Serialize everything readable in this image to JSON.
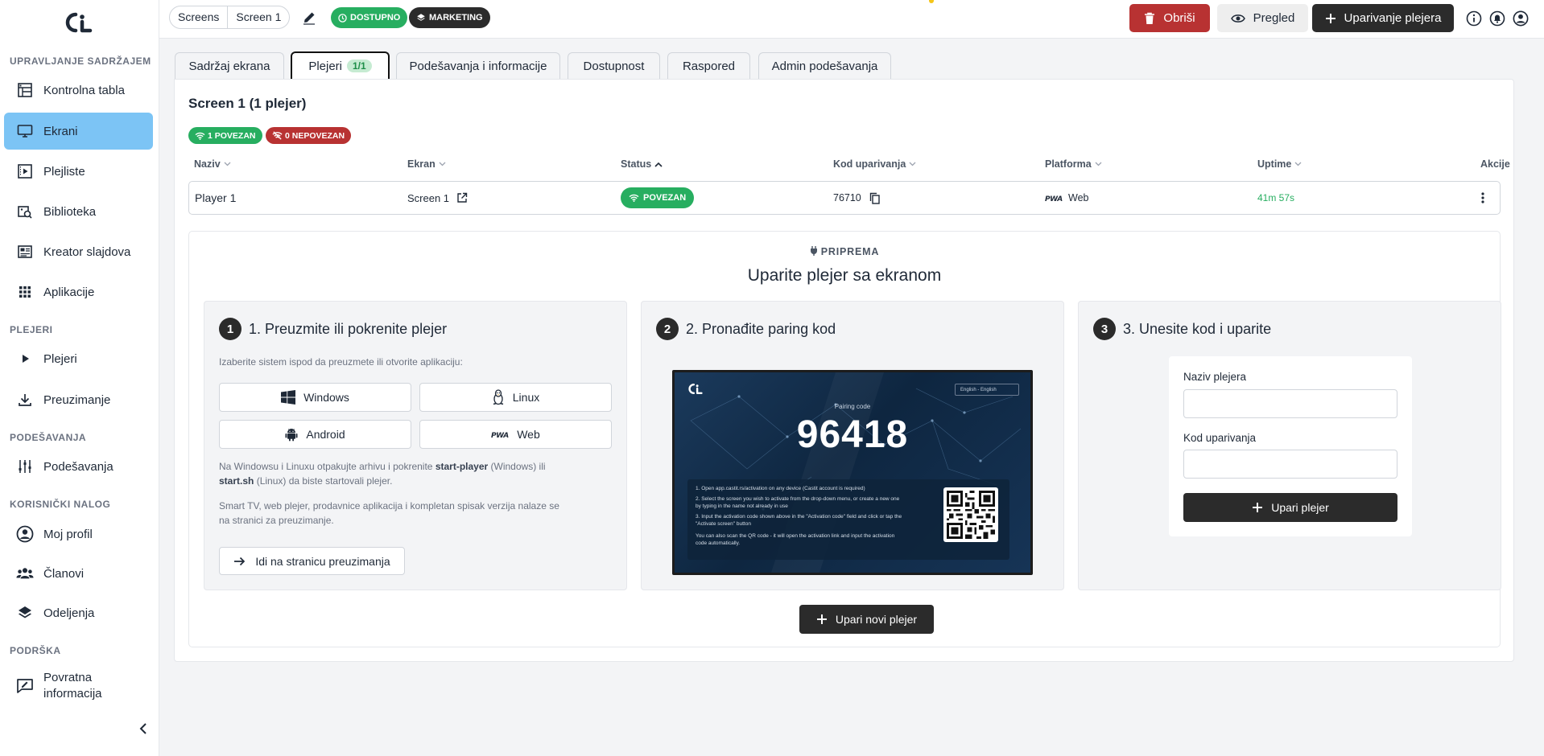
{
  "sidebar": {
    "sections": {
      "content": "UPRAVLJANJE SADRŽAJEM",
      "players": "PLEJERI",
      "settings": "PODEŠAVANJA",
      "account": "KORISNIČKI NALOG",
      "support": "PODRŠKA"
    },
    "items": {
      "dashboard": "Kontrolna tabla",
      "screens": "Ekrani",
      "playlists": "Plejliste",
      "library": "Biblioteka",
      "slide_creator": "Kreator slajdova",
      "apps": "Aplikacije",
      "players": "Plejeri",
      "downloads": "Preuzimanje",
      "settings": "Podešavanja",
      "profile": "Moj profil",
      "members": "Članovi",
      "departments": "Odeljenja",
      "feedback_line1": "Povratna",
      "feedback_line2": "informacija"
    },
    "active_color": "#7cc4f5"
  },
  "topbar": {
    "breadcrumb": [
      "Screens",
      "Screen 1"
    ],
    "status_badge": "DOSTUPNO",
    "group_badge": "MARKETING",
    "delete_label": "Obriši",
    "preview_label": "Pregled",
    "pair_label": "Uparivanje plejera"
  },
  "tabs": [
    {
      "label": "Sadržaj ekrana"
    },
    {
      "label": "Plejeri",
      "count": "1/1"
    },
    {
      "label": "Podešavanja i informacije"
    },
    {
      "label": "Dostupnost"
    },
    {
      "label": "Raspored"
    },
    {
      "label": "Admin podešavanja"
    }
  ],
  "main": {
    "title": "Screen 1 (1 plejer)",
    "connected_badge": "1 POVEZAN",
    "disconnected_badge": "0 NEPOVEZAN",
    "columns": [
      "Naziv",
      "Ekran",
      "Status",
      "Kod uparivanja",
      "Platforma",
      "Uptime",
      "Akcije"
    ],
    "rows": [
      {
        "name": "Player 1",
        "screen": "Screen 1",
        "status": "POVEZAN",
        "code": "76710",
        "platform": "Web",
        "uptime": "41m 57s"
      }
    ]
  },
  "pairing": {
    "overline": "PRIPREMA",
    "title": "Uparite plejer sa ekranom",
    "step1": {
      "num": "1",
      "title": "1. Preuzmite ili pokrenite plejer",
      "sub": "Izaberite sistem ispod da preuzmete ili otvorite aplikaciju:",
      "windows": "Windows",
      "linux": "Linux",
      "android": "Android",
      "web": "Web",
      "p1_a": "Na Windowsu i Linuxu otpakujte arhivu i pokrenite ",
      "p1_b": "start-player",
      "p1_c": " (Windows) ili",
      "p1_d": "start.sh",
      "p1_e": " (Linux) da biste startovali plejer.",
      "p2_line1": "Smart TV, web plejer, prodavnice aplikacija i kompletan spisak verzija nalaze se",
      "p2_line2": "na stranici za preuzimanje.",
      "download_btn": "Idi na stranicu preuzimanja"
    },
    "step2": {
      "num": "2",
      "title": "2. Pronađite paring kod",
      "tv_lang": "English - English",
      "tv_pairing_label": "Pairing code",
      "tv_code": "96418",
      "tv_step1": "1. Open app.castit.rs/activation on any device (Castit account is required)",
      "tv_step2": "2. Select the screen you wish to activate from the drop-down menu, or create a new one by typing in the name not already in use",
      "tv_step3": "3. Input the activation code shown above in the \"Activation code\" field and click or tap the \"Activate screen\" button",
      "tv_step4": "You can also scan the QR code - it will open the activation link and input the activation code automatically."
    },
    "step3": {
      "num": "3",
      "title": "3. Unesite kod i uparite",
      "name_label": "Naziv plejera",
      "name_value": "",
      "code_label": "Kod uparivanja",
      "code_value": "",
      "submit": "Upari plejer"
    },
    "new_player_btn": "Upari novi plejer"
  },
  "colors": {
    "green": "#27ae60",
    "red": "#b83232",
    "dark": "#2b2b2b"
  }
}
